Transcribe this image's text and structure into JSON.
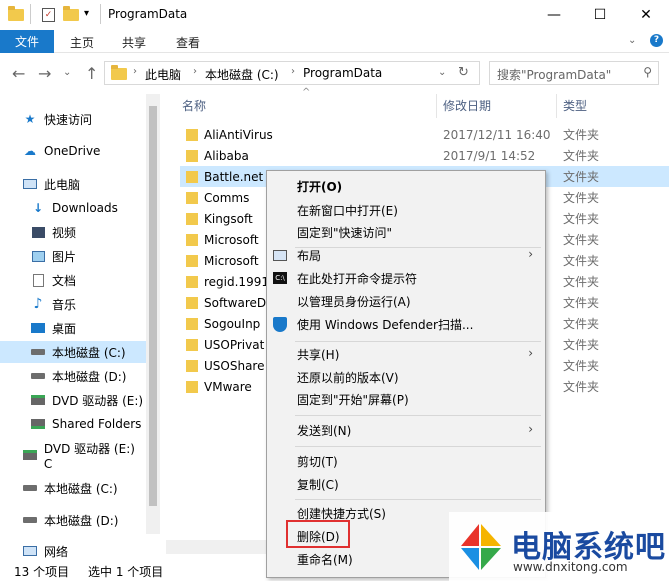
{
  "window": {
    "title": "ProgramData",
    "minimize": "—",
    "maximize": "☐",
    "close": "✕"
  },
  "ribbon": {
    "file_tab": "文件",
    "tabs": [
      "主页",
      "共享",
      "查看"
    ]
  },
  "address": {
    "crumbs": [
      "此电脑",
      "本地磁盘 (C:)",
      "ProgramData"
    ],
    "search_placeholder": "搜索\"ProgramData\""
  },
  "sidebar": {
    "items": [
      {
        "label": "快速访问",
        "icon": "star-icon"
      },
      {
        "label": "OneDrive",
        "icon": "cloud-icon"
      },
      {
        "label": "此电脑",
        "icon": "computer-icon"
      },
      {
        "label": "Downloads",
        "icon": "download-icon"
      },
      {
        "label": "视频",
        "icon": "video-icon"
      },
      {
        "label": "图片",
        "icon": "picture-icon"
      },
      {
        "label": "文档",
        "icon": "document-icon"
      },
      {
        "label": "音乐",
        "icon": "music-icon"
      },
      {
        "label": "桌面",
        "icon": "desktop-icon"
      },
      {
        "label": "本地磁盘 (C:)",
        "icon": "drive-icon"
      },
      {
        "label": "本地磁盘 (D:)",
        "icon": "drive-icon"
      },
      {
        "label": "DVD 驱动器 (E:)",
        "icon": "dvd-icon"
      },
      {
        "label": "Shared Folders",
        "icon": "network-drive-icon"
      },
      {
        "label": "DVD 驱动器 (E:) C",
        "icon": "dvd-icon"
      },
      {
        "label": "本地磁盘 (C:)",
        "icon": "drive-icon"
      },
      {
        "label": "本地磁盘 (D:)",
        "icon": "drive-icon"
      },
      {
        "label": "网络",
        "icon": "network-icon"
      }
    ]
  },
  "columns": {
    "name": "名称",
    "date": "修改日期",
    "type": "类型"
  },
  "files": [
    {
      "name": "AliAntiVirus",
      "date": "2017/12/11 16:40",
      "type": "文件夹"
    },
    {
      "name": "Alibaba",
      "date": "2017/9/1 14:52",
      "type": "文件夹"
    },
    {
      "name": "Battle.net",
      "date": "",
      "type": "文件夹"
    },
    {
      "name": "Comms",
      "date": "",
      "type": "文件夹"
    },
    {
      "name": "Kingsoft",
      "date": "",
      "type": "文件夹"
    },
    {
      "name": "Microsoft",
      "date": "",
      "type": "文件夹"
    },
    {
      "name": "Microsoft",
      "date": "",
      "type": "文件夹"
    },
    {
      "name": "regid.1991",
      "date": "",
      "type": "文件夹"
    },
    {
      "name": "SoftwareD",
      "date": "",
      "type": "文件夹"
    },
    {
      "name": "SogouInp",
      "date": "",
      "type": "文件夹"
    },
    {
      "name": "USOPrivat",
      "date": "",
      "type": "文件夹"
    },
    {
      "name": "USOShare",
      "date": "",
      "type": "文件夹"
    },
    {
      "name": "VMware",
      "date": "",
      "type": "文件夹"
    }
  ],
  "status": {
    "count": "13 个项目",
    "selected": "选中 1 个项目"
  },
  "context_menu": {
    "open": "打开(O)",
    "open_new_window": "在新窗口中打开(E)",
    "pin_quick": "固定到\"快速访问\"",
    "layout": "布局",
    "open_cmd": "在此处打开命令提示符",
    "run_admin": "以管理员身份运行(A)",
    "defender": "使用 Windows Defender扫描...",
    "share": "共享(H)",
    "restore": "还原以前的版本(V)",
    "pin_start": "固定到\"开始\"屏幕(P)",
    "send_to": "发送到(N)",
    "cut": "剪切(T)",
    "copy": "复制(C)",
    "create_shortcut": "创建快捷方式(S)",
    "delete": "删除(D)",
    "rename": "重命名(M)"
  },
  "watermark": {
    "brand": "电脑系统吧",
    "url": "www.dnxitong.com"
  }
}
